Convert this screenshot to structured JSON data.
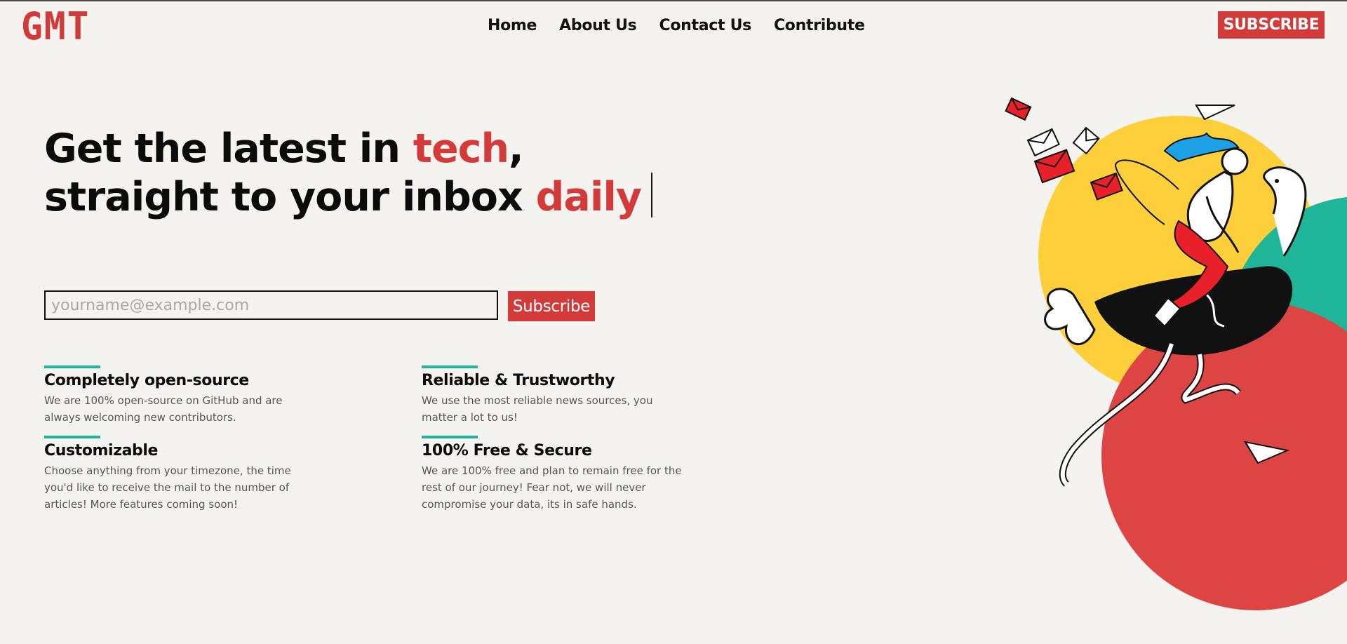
{
  "header": {
    "logo": "GMT",
    "nav": [
      "Home",
      "About Us",
      "Contact Us",
      "Contribute"
    ],
    "subscribe_label": "SUBSCRIBE"
  },
  "hero": {
    "headline_part1": "Get the latest in ",
    "headline_accent1": "tech",
    "headline_part2": ", straight to your inbox ",
    "headline_accent2": "daily",
    "email_placeholder": "yourname@example.com",
    "email_value": "",
    "subscribe_label": "Subscribe"
  },
  "features": [
    {
      "title": "Completely open-source",
      "desc": "We are 100% open-source on GitHub and are always welcoming new contributors."
    },
    {
      "title": "Reliable & Trustworthy",
      "desc": "We use the most reliable news sources, you matter a lot to us!"
    },
    {
      "title": "Customizable",
      "desc": "Choose anything from your timezone, the time you'd like to receive the mail to the number of articles! More features coming soon!"
    },
    {
      "title": "100% Free & Secure",
      "desc": "We are 100% free and plan to remain free for the rest of our journey! Fear not, we will never compromise your data, its in safe hands."
    }
  ],
  "colors": {
    "brand_red": "#d33a3a",
    "accent_teal": "#1fb598",
    "accent_yellow": "#fdd03b",
    "background": "#f5f3f0"
  },
  "icons": [
    "envelope-icon",
    "paper-plane-icon"
  ]
}
